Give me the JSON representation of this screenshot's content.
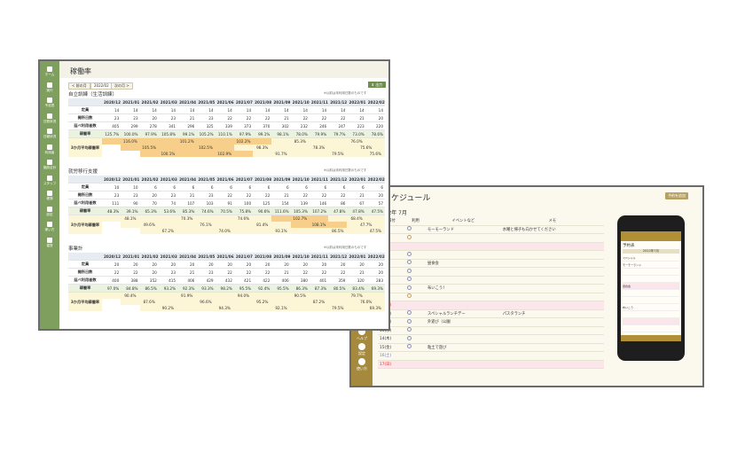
{
  "back": {
    "title": "スケジュール",
    "month": "2022年 7月",
    "add_button": "予約を追加",
    "col_date": "日付",
    "col_attend": "利用",
    "col_event": "イベントなど",
    "col_memo": "メモ",
    "sidebar": [
      {
        "label": "ホーム"
      },
      {
        "label": "記録"
      },
      {
        "label": "予定表"
      },
      {
        "label": "設定"
      },
      {
        "label": "利用者"
      },
      {
        "label": "施設"
      },
      {
        "label": "お知らせ"
      },
      {
        "label": "スタッフ"
      },
      {
        "label": "ログアウト"
      },
      {
        "label": "ヘルプ"
      },
      {
        "label": "設定"
      },
      {
        "label": "使い方"
      }
    ],
    "rows": [
      {
        "date": "1(金)",
        "type": "wd",
        "mark": "blue",
        "event": "モーモーランド",
        "memo": "水曜と帰子も向かせてください"
      },
      {
        "date": "2(土)",
        "type": "sat",
        "mark": "orange",
        "event": "",
        "memo": ""
      },
      {
        "date": "3(日)",
        "type": "sun",
        "mark": "",
        "event": "",
        "memo": ""
      },
      {
        "date": "4(月)",
        "type": "wd",
        "mark": "blue",
        "event": "",
        "memo": ""
      },
      {
        "date": "5(火)",
        "type": "wd",
        "mark": "blue",
        "event": "昼食会",
        "memo": ""
      },
      {
        "date": "6(水)",
        "type": "wd",
        "mark": "blue",
        "event": "",
        "memo": ""
      },
      {
        "date": "7(木)",
        "type": "wd",
        "mark": "blue",
        "event": "",
        "memo": ""
      },
      {
        "date": "8(金)",
        "type": "wd",
        "mark": "blue",
        "event": "布いこう！",
        "memo": ""
      },
      {
        "date": "9(土)",
        "type": "sat",
        "mark": "orange",
        "event": "",
        "memo": ""
      },
      {
        "date": "10(日)",
        "type": "sun",
        "mark": "",
        "event": "",
        "memo": ""
      },
      {
        "date": "11(月)",
        "type": "wd",
        "mark": "blue",
        "event": "スペシャルランチデー",
        "memo": "パスタランチ"
      },
      {
        "date": "12(火)",
        "type": "wd",
        "mark": "blue",
        "event": "外遊び（公園",
        "memo": ""
      },
      {
        "date": "13(水)",
        "type": "wd",
        "mark": "blue",
        "event": "",
        "memo": ""
      },
      {
        "date": "14(木)",
        "type": "wd",
        "mark": "blue",
        "event": "",
        "memo": ""
      },
      {
        "date": "15(金)",
        "type": "wd",
        "mark": "blue",
        "event": "粘土で遊び",
        "memo": ""
      },
      {
        "date": "16(土)",
        "type": "sat",
        "mark": "",
        "event": "",
        "memo": ""
      },
      {
        "date": "17(日)",
        "type": "sun",
        "mark": "",
        "event": "",
        "memo": ""
      }
    ],
    "phone": {
      "header": "予約表",
      "month": "2022年7月",
      "rows": [
        "スペシャル",
        "モーモーランド",
        "",
        "",
        "昼食会",
        "",
        "",
        "布いこう",
        "",
        "",
        "",
        "",
        ""
      ]
    }
  },
  "front": {
    "title": "稼働率",
    "prev": "< 前の月",
    "period": "2022/02",
    "next": "次の月 >",
    "export": "出力",
    "sidebar": [
      {
        "label": "ホーム"
      },
      {
        "label": "実行"
      },
      {
        "label": "予定表"
      },
      {
        "label": "日割状況"
      },
      {
        "label": "日報状況"
      },
      {
        "label": "利用者"
      },
      {
        "label": "施設合計"
      },
      {
        "label": "スタッフ"
      },
      {
        "label": "帳簿"
      },
      {
        "label": "設定"
      },
      {
        "label": "使い方"
      },
      {
        "label": "運営"
      }
    ],
    "months": [
      "2020/12",
      "2021/01",
      "2021/02",
      "2021/03",
      "2021/04",
      "2021/05",
      "2021/06",
      "2021/07",
      "2021/08",
      "2021/09",
      "2021/10",
      "2021/11",
      "2021/12",
      "2022/01",
      "2022/02"
    ],
    "row_labels": {
      "capacity": "定員",
      "days": "開所日数",
      "users": "延べ利用者数",
      "rate": "稼働率",
      "avg": "3か月平均稼働率"
    },
    "note": "※以前は未利用日数のものです",
    "sections": [
      {
        "title": "自立訓練（生活訓練）",
        "capacity": [
          "14",
          "14",
          "14",
          "14",
          "14",
          "14",
          "14",
          "14",
          "14",
          "14",
          "14",
          "14",
          "14",
          "14",
          "14"
        ],
        "days": [
          "23",
          "23",
          "20",
          "23",
          "21",
          "23",
          "22",
          "22",
          "22",
          "21",
          "22",
          "22",
          "22",
          "21",
          "20"
        ],
        "users": [
          "405",
          "299",
          "278",
          "341",
          "296",
          "325",
          "339",
          "373",
          "370",
          "302",
          "232",
          "246",
          "247",
          "223",
          "220"
        ],
        "rate": [
          "125.7%",
          "100.0%",
          "97.9%",
          "105.8%",
          "99.1%",
          "105.2%",
          "110.1%",
          "97.9%",
          "99.1%",
          "98.1%",
          "78.0%",
          "79.9%",
          "79.7%",
          "73.0%",
          "78.6%"
        ],
        "avg": [
          {
            "col": 1,
            "span": 3,
            "value": "116.0%",
            "level": "hi"
          },
          {
            "col": 4,
            "span": 3,
            "value": "101.2%",
            "level": "hi"
          },
          {
            "col": 7,
            "span": 3,
            "value": "102.2%",
            "level": "hi"
          },
          {
            "col": 10,
            "span": 3,
            "value": "85.3%",
            "level": "lo"
          },
          {
            "col": 13,
            "span": 3,
            "value": "76.0%",
            "level": "lo"
          }
        ],
        "avg2": [
          {
            "col": 2,
            "span": 3,
            "value": "105.5%",
            "level": "hi"
          },
          {
            "col": 5,
            "span": 3,
            "value": "102.5%",
            "level": "hi"
          },
          {
            "col": 8,
            "span": 3,
            "value": "98.3%",
            "level": "lo"
          },
          {
            "col": 11,
            "span": 3,
            "value": "78.3%",
            "level": "lo"
          },
          {
            "col": 14,
            "span": 2,
            "value": "75.6%",
            "level": "lo"
          }
        ],
        "avg3": [
          {
            "col": 3,
            "span": 3,
            "value": "100.1%",
            "level": "hi"
          },
          {
            "col": 6,
            "span": 3,
            "value": "102.9%",
            "level": "hi"
          },
          {
            "col": 9,
            "span": 3,
            "value": "91.7%",
            "level": "lo"
          },
          {
            "col": 12,
            "span": 3,
            "value": "79.5%",
            "level": "lo"
          },
          {
            "col": 15,
            "span": 1,
            "value": "75.6%",
            "level": "lo"
          }
        ]
      },
      {
        "title": "就労移行支援",
        "capacity": [
          "10",
          "10",
          "6",
          "6",
          "6",
          "6",
          "6",
          "6",
          "6",
          "6",
          "6",
          "6",
          "6",
          "6",
          "6"
        ],
        "days": [
          "23",
          "23",
          "20",
          "23",
          "21",
          "23",
          "22",
          "22",
          "22",
          "21",
          "22",
          "22",
          "22",
          "21",
          "20"
        ],
        "users": [
          "111",
          "90",
          "70",
          "74",
          "107",
          "103",
          "91",
          "100",
          "125",
          "154",
          "139",
          "146",
          "86",
          "67",
          "57"
        ],
        "rate": [
          "48.3%",
          "39.1%",
          "65.3%",
          "53.6%",
          "85.3%",
          "74.6%",
          "70.5%",
          "75.8%",
          "90.6%",
          "111.6%",
          "105.3%",
          "107.2%",
          "47.8%",
          "47.8%",
          "47.5%"
        ],
        "avg": [
          {
            "col": 1,
            "span": 3,
            "value": "48.1%",
            "level": "lo"
          },
          {
            "col": 4,
            "span": 3,
            "value": "70.3%",
            "level": "lo"
          },
          {
            "col": 7,
            "span": 3,
            "value": "74.6%",
            "level": "lo"
          },
          {
            "col": 10,
            "span": 3,
            "value": "102.7%",
            "level": "hi"
          },
          {
            "col": 13,
            "span": 3,
            "value": "68.4%",
            "level": "lo"
          }
        ],
        "avg2": [
          {
            "col": 2,
            "span": 3,
            "value": "49.6%",
            "level": "lo"
          },
          {
            "col": 5,
            "span": 3,
            "value": "76.1%",
            "level": "lo"
          },
          {
            "col": 8,
            "span": 3,
            "value": "81.4%",
            "level": "lo"
          },
          {
            "col": 11,
            "span": 3,
            "value": "108.1%",
            "level": "hi"
          },
          {
            "col": 14,
            "span": 2,
            "value": "47.7%",
            "level": "lo"
          }
        ],
        "avg3": [
          {
            "col": 3,
            "span": 3,
            "value": "67.2%",
            "level": "lo"
          },
          {
            "col": 6,
            "span": 3,
            "value": "74.0%",
            "level": "lo"
          },
          {
            "col": 9,
            "span": 3,
            "value": "93.1%",
            "level": "lo"
          },
          {
            "col": 12,
            "span": 3,
            "value": "86.5%",
            "level": "lo"
          },
          {
            "col": 15,
            "span": 1,
            "value": "47.5%",
            "level": "lo"
          }
        ]
      },
      {
        "title": "事業計",
        "capacity": [
          "20",
          "20",
          "20",
          "20",
          "20",
          "20",
          "20",
          "20",
          "20",
          "20",
          "20",
          "20",
          "20",
          "20",
          "20"
        ],
        "days": [
          "22",
          "22",
          "20",
          "23",
          "21",
          "23",
          "22",
          "22",
          "22",
          "21",
          "22",
          "22",
          "22",
          "21",
          "20"
        ],
        "users": [
          "400",
          "388",
          "352",
          "415",
          "406",
          "429",
          "432",
          "421",
          "422",
          "406",
          "380",
          "401",
          "359",
          "320",
          "283"
        ],
        "rate": [
          "97.0%",
          "84.8%",
          "86.5%",
          "93.2%",
          "92.3%",
          "93.3%",
          "98.2%",
          "95.5%",
          "92.4%",
          "95.5%",
          "86.3%",
          "87.3%",
          "80.5%",
          "83.4%",
          "69.3%"
        ],
        "avg": [
          {
            "col": 1,
            "span": 3,
            "value": "90.4%",
            "level": "lo"
          },
          {
            "col": 4,
            "span": 3,
            "value": "91.9%",
            "level": "lo"
          },
          {
            "col": 7,
            "span": 3,
            "value": "94.0%",
            "level": "lo"
          },
          {
            "col": 10,
            "span": 3,
            "value": "90.5%",
            "level": "lo"
          },
          {
            "col": 13,
            "span": 3,
            "value": "79.7%",
            "level": "lo"
          }
        ],
        "avg2": [
          {
            "col": 2,
            "span": 3,
            "value": "87.6%",
            "level": "lo"
          },
          {
            "col": 5,
            "span": 3,
            "value": "96.6%",
            "level": "lo"
          },
          {
            "col": 8,
            "span": 3,
            "value": "95.2%",
            "level": "lo"
          },
          {
            "col": 11,
            "span": 3,
            "value": "87.2%",
            "level": "lo"
          },
          {
            "col": 14,
            "span": 2,
            "value": "76.0%",
            "level": "lo"
          }
        ],
        "avg3": [
          {
            "col": 3,
            "span": 3,
            "value": "90.2%",
            "level": "lo"
          },
          {
            "col": 6,
            "span": 3,
            "value": "94.3%",
            "level": "lo"
          },
          {
            "col": 9,
            "span": 3,
            "value": "92.1%",
            "level": "lo"
          },
          {
            "col": 12,
            "span": 3,
            "value": "79.5%",
            "level": "lo"
          },
          {
            "col": 15,
            "span": 1,
            "value": "69.3%",
            "level": "lo"
          }
        ]
      }
    ]
  }
}
